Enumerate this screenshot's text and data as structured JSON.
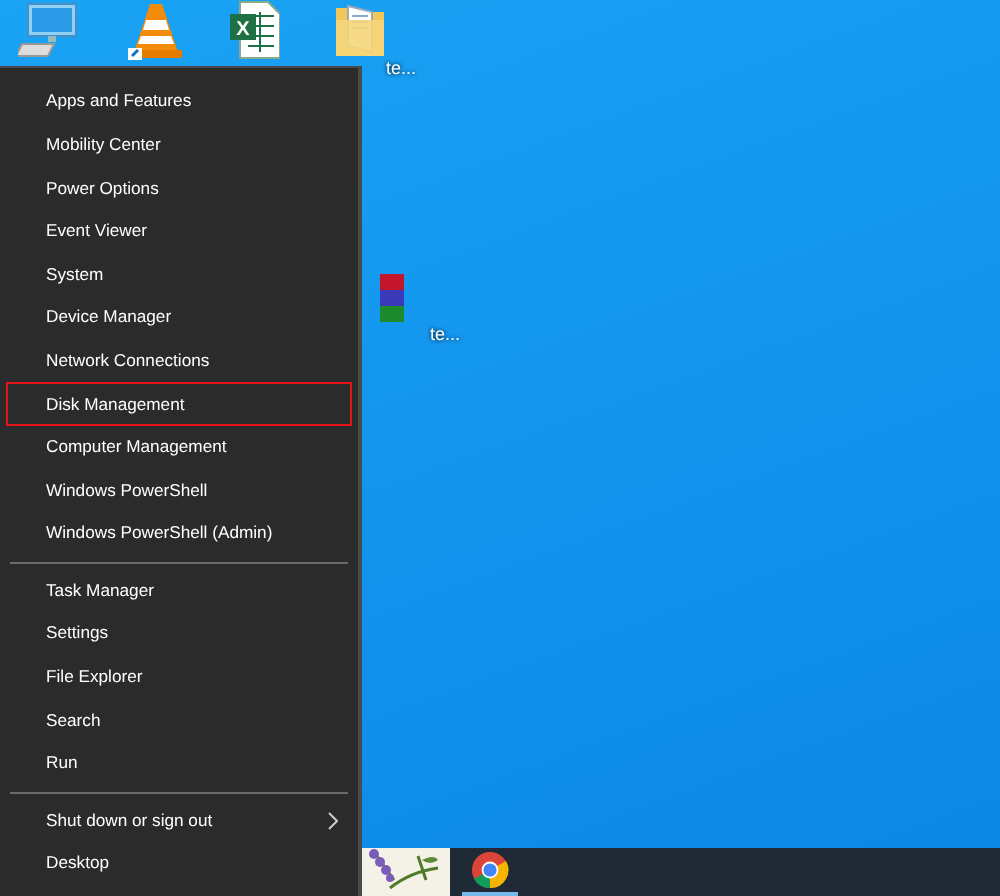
{
  "desktop_icons": [
    {
      "kind": "computer"
    },
    {
      "kind": "cone"
    },
    {
      "kind": "spreadsheet",
      "letter": "X"
    },
    {
      "kind": "folder",
      "label": "te..."
    },
    {
      "kind": "books",
      "label": "te..."
    }
  ],
  "menu": {
    "groups": [
      {
        "items": [
          {
            "label": "Apps and Features",
            "highlighted": false,
            "has_submenu": false
          },
          {
            "label": "Mobility Center",
            "highlighted": false,
            "has_submenu": false
          },
          {
            "label": "Power Options",
            "highlighted": false,
            "has_submenu": false
          },
          {
            "label": "Event Viewer",
            "highlighted": false,
            "has_submenu": false
          },
          {
            "label": "System",
            "highlighted": false,
            "has_submenu": false
          },
          {
            "label": "Device Manager",
            "highlighted": false,
            "has_submenu": false
          },
          {
            "label": "Network Connections",
            "highlighted": false,
            "has_submenu": false
          },
          {
            "label": "Disk Management",
            "highlighted": true,
            "has_submenu": false
          },
          {
            "label": "Computer Management",
            "highlighted": false,
            "has_submenu": false
          },
          {
            "label": "Windows PowerShell",
            "highlighted": false,
            "has_submenu": false
          },
          {
            "label": "Windows PowerShell (Admin)",
            "highlighted": false,
            "has_submenu": false
          }
        ]
      },
      {
        "items": [
          {
            "label": "Task Manager",
            "highlighted": false,
            "has_submenu": false
          },
          {
            "label": "Settings",
            "highlighted": false,
            "has_submenu": false
          },
          {
            "label": "File Explorer",
            "highlighted": false,
            "has_submenu": false
          },
          {
            "label": "Search",
            "highlighted": false,
            "has_submenu": false
          },
          {
            "label": "Run",
            "highlighted": false,
            "has_submenu": false
          }
        ]
      },
      {
        "items": [
          {
            "label": "Shut down or sign out",
            "highlighted": false,
            "has_submenu": true
          },
          {
            "label": "Desktop",
            "highlighted": false,
            "has_submenu": false
          }
        ]
      }
    ]
  },
  "taskbar": {
    "items": [
      {
        "kind": "photo",
        "running": false
      },
      {
        "kind": "browser",
        "running": true
      }
    ]
  }
}
